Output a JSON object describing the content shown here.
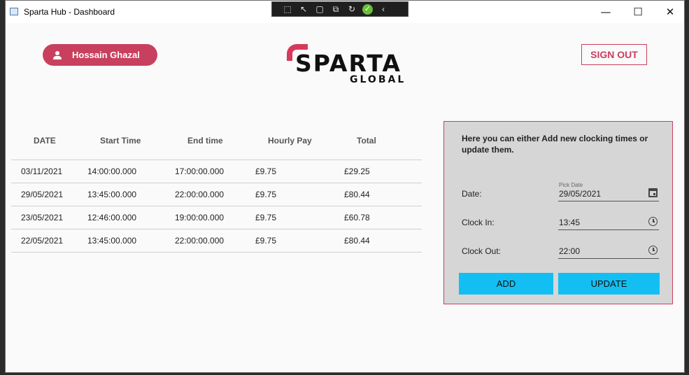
{
  "window": {
    "title": "Sparta Hub - Dashboard",
    "controls": {
      "minimize": "—",
      "maximize": "☐",
      "close": "✕"
    }
  },
  "debug_toolbar": {
    "icons": [
      "select-element-icon",
      "cursor-icon",
      "frame-icon",
      "layout-icon",
      "hot-reload-icon",
      "check-icon",
      "collapse-icon"
    ]
  },
  "header": {
    "user_name": "Hossain Ghazal",
    "logo_main": "SPARTA",
    "logo_sub": "GLOBAL",
    "signout_label": "SIGN OUT"
  },
  "table": {
    "columns": [
      "DATE",
      "Start Time",
      "End time",
      "Hourly Pay",
      "Total"
    ],
    "rows": [
      [
        "03/11/2021",
        "14:00:00.000",
        "17:00:00.000",
        "£9.75",
        "£29.25"
      ],
      [
        "29/05/2021",
        "13:45:00.000",
        "22:00:00.000",
        "£9.75",
        "£80.44"
      ],
      [
        "23/05/2021",
        "12:46:00.000",
        "19:00:00.000",
        "£9.75",
        "£60.78"
      ],
      [
        "22/05/2021",
        "13:45:00.000",
        "22:00:00.000",
        "£9.75",
        "£80.44"
      ]
    ]
  },
  "panel": {
    "intro": "Here you can either Add new clocking times or update them.",
    "date_label": "Date:",
    "date_hint": "Pick Date",
    "date_value": "29/05/2021",
    "clock_in_label": "Clock In:",
    "clock_in_value": "13:45",
    "clock_out_label": "Clock Out:",
    "clock_out_value": "22:00",
    "add_label": "ADD",
    "update_label": "UPDATE"
  },
  "colors": {
    "accent": "#c9405e",
    "button": "#13bff2",
    "panel_bg": "#d6d6d6"
  }
}
